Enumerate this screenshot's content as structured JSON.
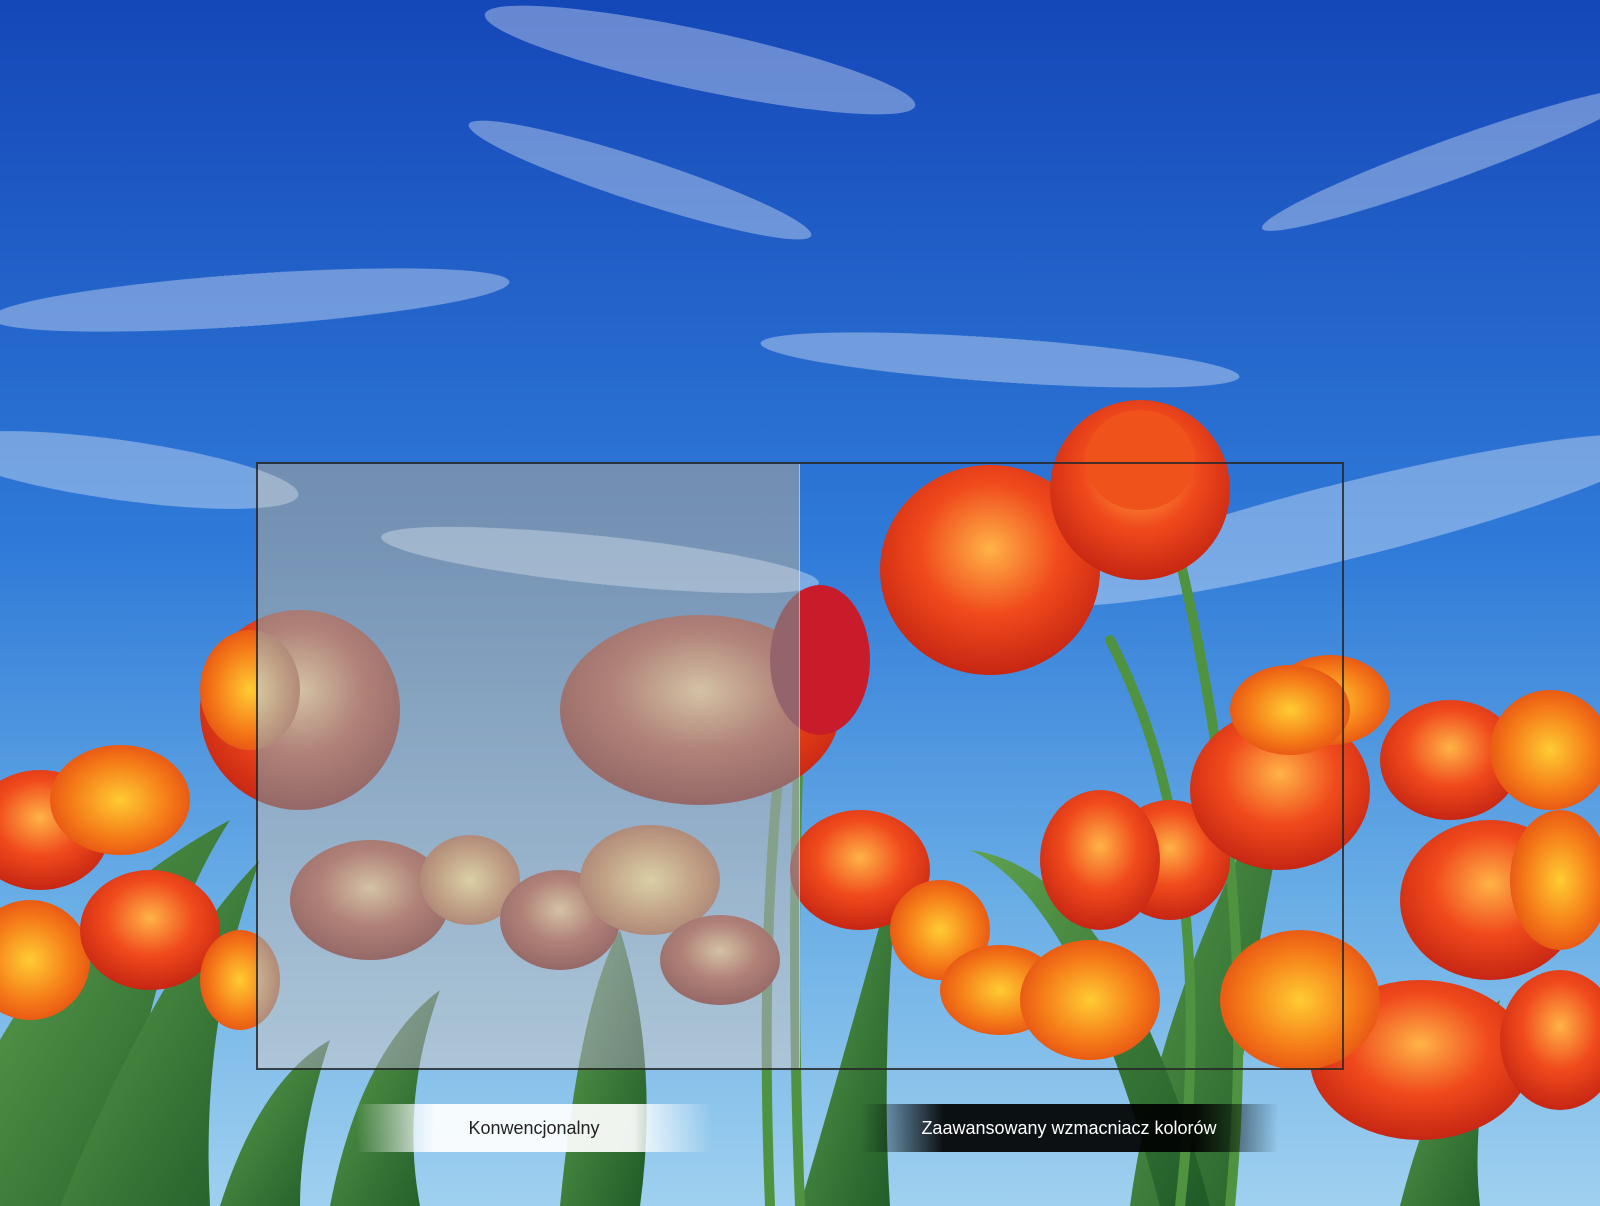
{
  "comparison": {
    "left_label": "Konwencjonalny",
    "right_label": "Zaawansowany wzmacniacz kolorów"
  },
  "colors": {
    "sky": "#1a5fc9",
    "petal_red": "#e8321a",
    "petal_orange": "#f7931e",
    "stem_green": "#3f8a3a"
  }
}
